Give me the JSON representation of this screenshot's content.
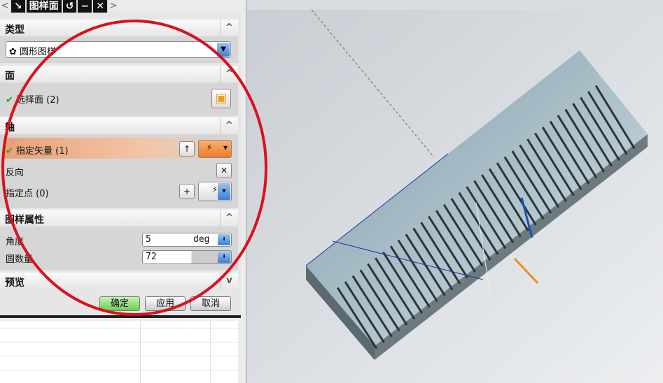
{
  "titlebar": {
    "title": "图样面",
    "back_icon": "chevron-left",
    "forward_icon": "chevron-right"
  },
  "sections": {
    "type": {
      "label": "类型",
      "value": "圆形图样"
    },
    "face": {
      "label": "面",
      "select": "选择面 (2)"
    },
    "axis": {
      "label": "轴",
      "vector": "指定矢量 (1)",
      "reverse": "反向",
      "point": "指定点 (0)"
    },
    "props": {
      "label": "图样属性",
      "angle_label": "角度",
      "angle_value": "5",
      "angle_unit": "deg",
      "count_label": "圆数量",
      "count_value": "72"
    },
    "preview": {
      "label": "预览"
    }
  },
  "buttons": {
    "ok": "确定",
    "apply": "应用",
    "cancel": "取消"
  },
  "colors": {
    "highlight": "#f0b48a",
    "annotation": "#d8121e",
    "ok_button": "#7fd36a"
  }
}
